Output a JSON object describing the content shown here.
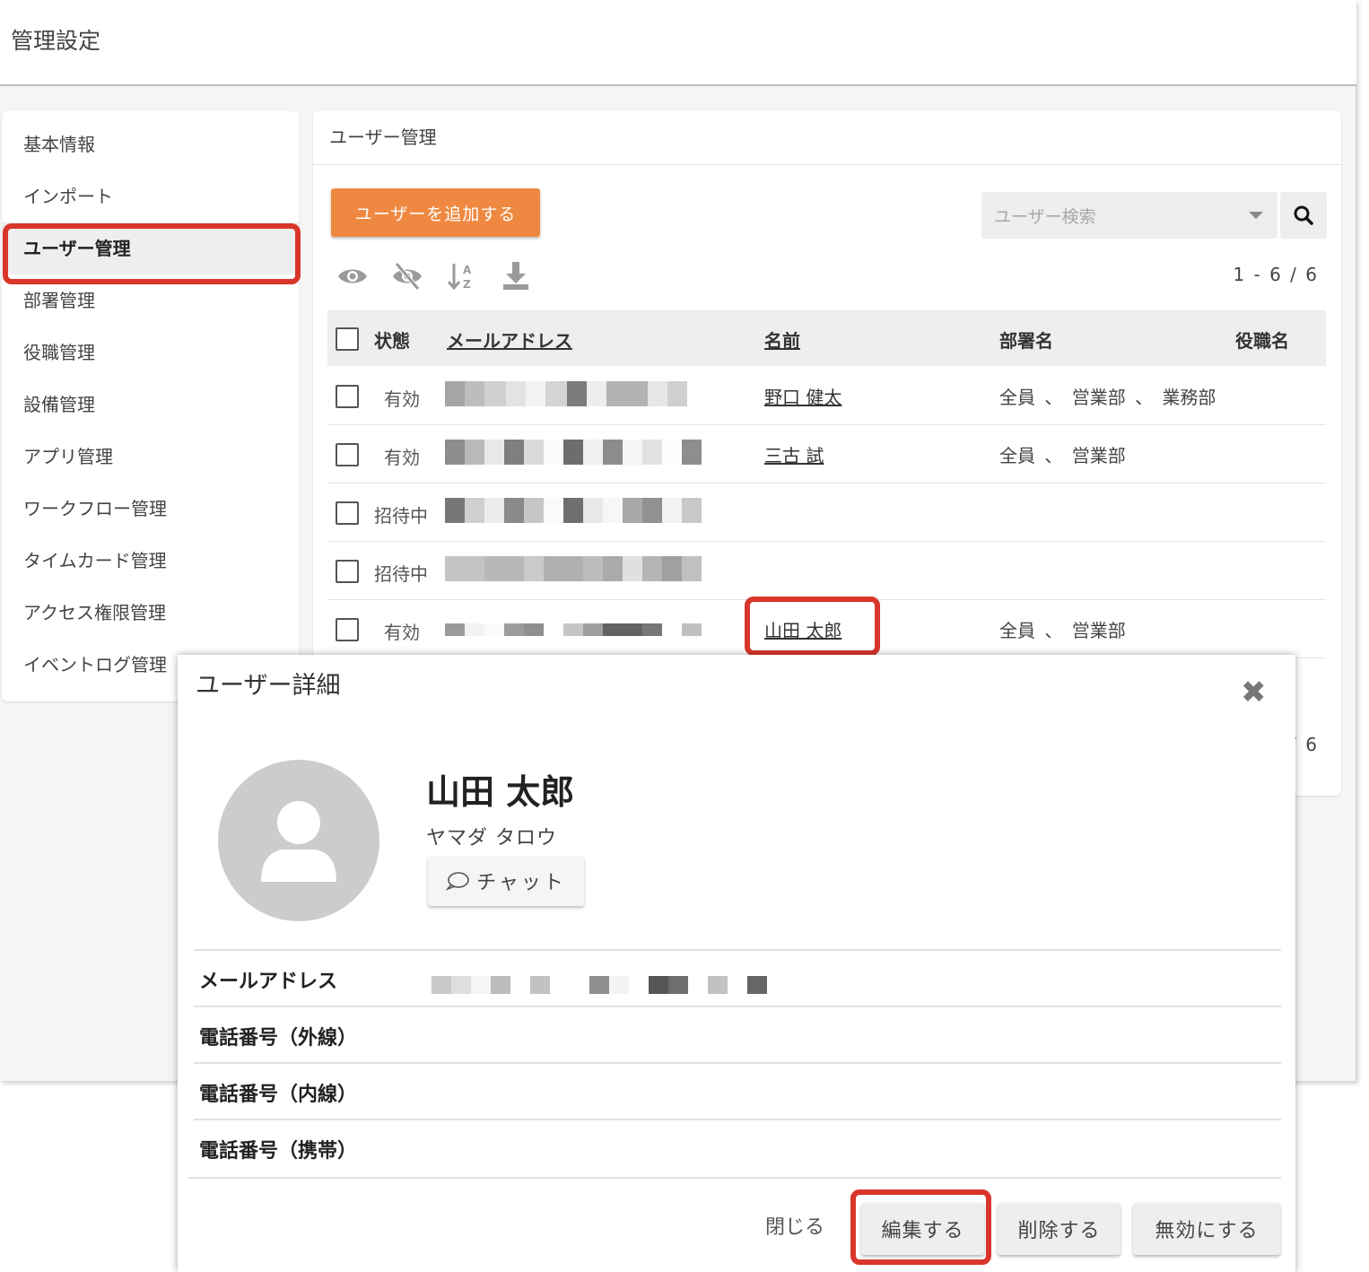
{
  "header": {
    "title": "管理設定"
  },
  "sidebar": {
    "items": [
      {
        "label": "基本情報"
      },
      {
        "label": "インポート"
      },
      {
        "label": "ユーザー管理"
      },
      {
        "label": "部署管理"
      },
      {
        "label": "役職管理"
      },
      {
        "label": "設備管理"
      },
      {
        "label": "アプリ管理"
      },
      {
        "label": "ワークフロー管理"
      },
      {
        "label": "タイムカード管理"
      },
      {
        "label": "アクセス権限管理"
      },
      {
        "label": "イベントログ管理"
      }
    ],
    "active_index": 2
  },
  "panel": {
    "title": "ユーザー管理",
    "add_button": "ユーザーを追加する",
    "search_placeholder": "ユーザー検索",
    "toolbar_icons": [
      "eye-icon",
      "eye-off-icon",
      "sort-az-icon",
      "download-icon"
    ],
    "count_top": "1 - 6 / 6",
    "count_bottom": "/ 6"
  },
  "table": {
    "headers": {
      "status": "状態",
      "email": "メールアドレス",
      "name": "名前",
      "dept": "部署名",
      "role": "役職名"
    },
    "rows": [
      {
        "status": "有効",
        "name": "野口 健太",
        "dept": "全員 、 営業部 、 業務部"
      },
      {
        "status": "有効",
        "name": "三古 試",
        "dept": "全員 、 営業部"
      },
      {
        "status": "招待中",
        "name": "",
        "dept": ""
      },
      {
        "status": "招待中",
        "name": "",
        "dept": ""
      },
      {
        "status": "有効",
        "name": "山田 太郎",
        "dept": "全員 、 営業部"
      }
    ]
  },
  "dialog": {
    "title": "ユーザー詳細",
    "name": "山田 太郎",
    "kana": "ヤマダ タロウ",
    "chat_label": "チャット",
    "fields": [
      {
        "label": "メールアドレス"
      },
      {
        "label": "電話番号（外線）"
      },
      {
        "label": "電話番号（内線）"
      },
      {
        "label": "電話番号（携帯）"
      }
    ],
    "buttons": {
      "close": "閉じる",
      "edit": "編集する",
      "delete": "削除する",
      "disable": "無効にする"
    }
  },
  "colors": {
    "accent": "#ef8941",
    "highlight_box": "#d9362b",
    "avatar": "#cccccc"
  }
}
